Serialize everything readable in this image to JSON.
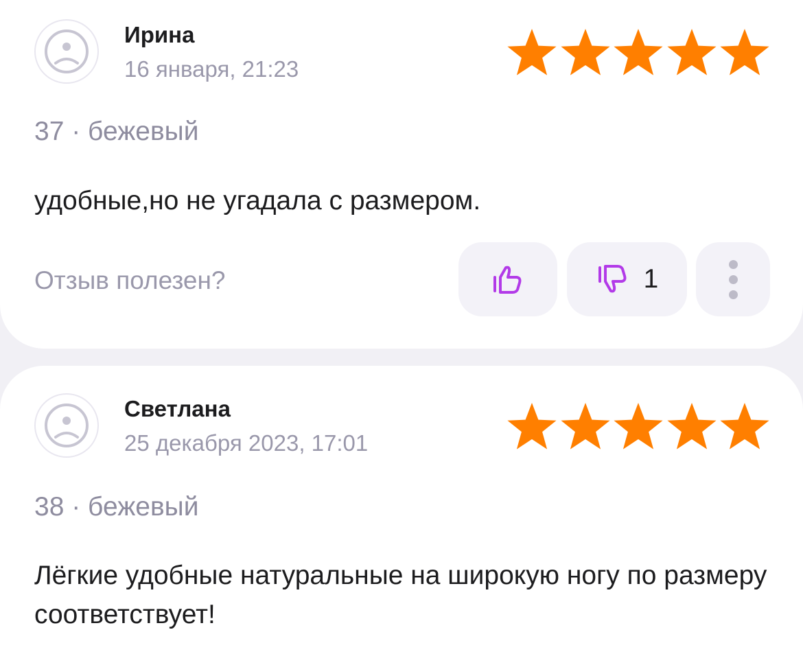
{
  "reviews": [
    {
      "author": "Ирина",
      "date": "16 января, 21:23",
      "rating": 5,
      "variant": "37 · бежевый",
      "text": "удобные,но не угадала с размером.",
      "helpful_prompt": "Отзыв полезен?",
      "dislike_count": "1"
    },
    {
      "author": "Светлана",
      "date": "25 декабря 2023, 17:01",
      "rating": 5,
      "variant": "38 · бежевый",
      "text": "Лёгкие удобные натуральные на широкую ногу по размеру соответствует!"
    }
  ],
  "colors": {
    "star": "#ff7f00",
    "vote_icon": "#b23ae8",
    "card_bg": "#ffffff",
    "page_bg": "#f1f0f5",
    "muted_text": "#9a98ab"
  },
  "icons": {
    "avatar": "sad-face-icon",
    "like": "thumbs-up-icon",
    "dislike": "thumbs-down-icon",
    "more": "vertical-dots-icon",
    "rating": "star-icon"
  }
}
